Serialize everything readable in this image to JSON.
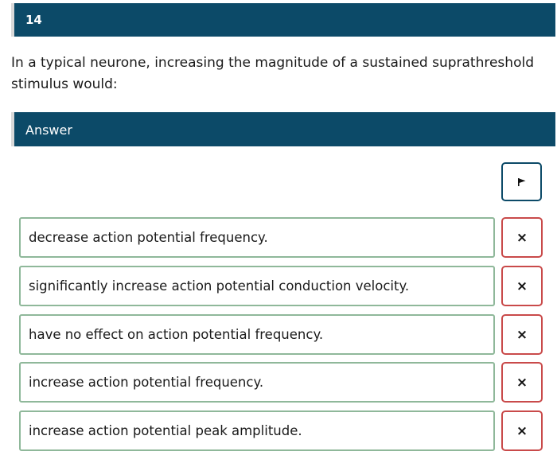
{
  "question": {
    "number": "14",
    "text": "In a typical neurone, increasing the magnitude of a sustained suprathreshold stimulus would:"
  },
  "answer_section": {
    "label": "Answer"
  },
  "flag_button": {
    "icon": "flag-icon"
  },
  "options": [
    {
      "text": "decrease action potential frequency.",
      "eliminate_icon": "×"
    },
    {
      "text": "significantly increase action potential conduction velocity.",
      "eliminate_icon": "×"
    },
    {
      "text": "have no effect on action potential frequency.",
      "eliminate_icon": "×"
    },
    {
      "text": "increase action potential frequency.",
      "eliminate_icon": "×"
    },
    {
      "text": "increase action potential peak amplitude.",
      "eliminate_icon": "×"
    }
  ],
  "colors": {
    "header_bg": "#0c4a68",
    "option_border": "#8fb89a",
    "eliminate_border": "#c94a4a"
  }
}
